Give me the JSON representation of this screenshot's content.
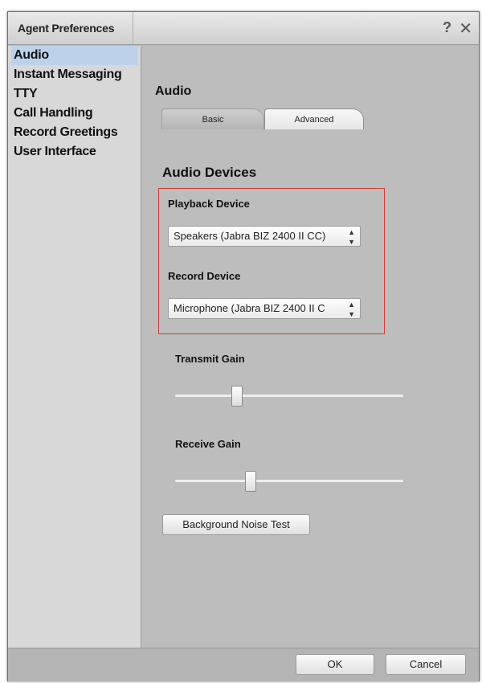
{
  "window": {
    "title": "Agent Preferences",
    "help_icon": "?",
    "close_icon": "✕"
  },
  "sidebar": {
    "items": [
      {
        "label": "Audio",
        "active": true
      },
      {
        "label": "Instant Messaging"
      },
      {
        "label": "TTY"
      },
      {
        "label": "Call Handling"
      },
      {
        "label": "Record Greetings"
      },
      {
        "label": "User Interface"
      }
    ]
  },
  "main": {
    "section_title": "Audio",
    "tabs": [
      {
        "label": "Basic",
        "selected": false
      },
      {
        "label": "Advanced",
        "selected": true
      }
    ],
    "devices_title": "Audio Devices",
    "playback": {
      "label": "Playback Device",
      "value": "Speakers (Jabra BIZ 2400 II CC)"
    },
    "record": {
      "label": "Record Device",
      "value": "Microphone (Jabra BIZ 2400 II C"
    },
    "transmit_gain": {
      "label": "Transmit Gain",
      "level_fraction": 0.27
    },
    "receive_gain": {
      "label": "Receive Gain",
      "level_fraction": 0.33
    },
    "noise_test_label": "Background Noise Test"
  },
  "footer": {
    "ok_label": "OK",
    "cancel_label": "Cancel"
  },
  "colors": {
    "highlight": "#d0393a",
    "active_nav": "#bcd2ea"
  }
}
